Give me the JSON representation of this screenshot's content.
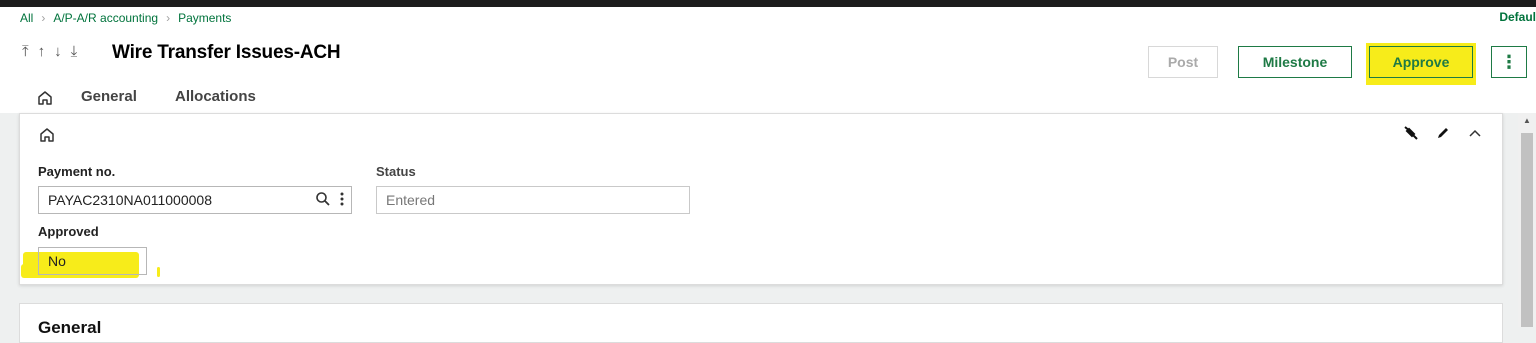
{
  "breadcrumb": [
    "All",
    "A/P-A/R accounting",
    "Payments"
  ],
  "header": {
    "default_label": "Defaul",
    "title": "Wire Transfer Issues-ACH",
    "buttons": {
      "post": "Post",
      "milestone": "Milestone",
      "approve": "Approve",
      "more": "⋮"
    },
    "nav_icons": [
      "first-record-icon",
      "previous-record-icon",
      "next-record-icon",
      "last-record-icon"
    ]
  },
  "tabs": {
    "home_icon": "home-icon",
    "general": "General",
    "allocations": "Allocations"
  },
  "card": {
    "tools": [
      "pin-icon",
      "edit-icon",
      "collapse-icon"
    ],
    "fields": {
      "payment_no_label": "Payment no.",
      "payment_no_value": "PAYAC2310NA011000008",
      "status_label": "Status",
      "status_placeholder": "Entered",
      "approved_label": "Approved",
      "approved_value": "No"
    }
  },
  "section2": {
    "title": "General"
  },
  "colors": {
    "accent": "#1e7a45",
    "highlight": "#f7ec1a",
    "breadcrumb": "#00733c"
  }
}
